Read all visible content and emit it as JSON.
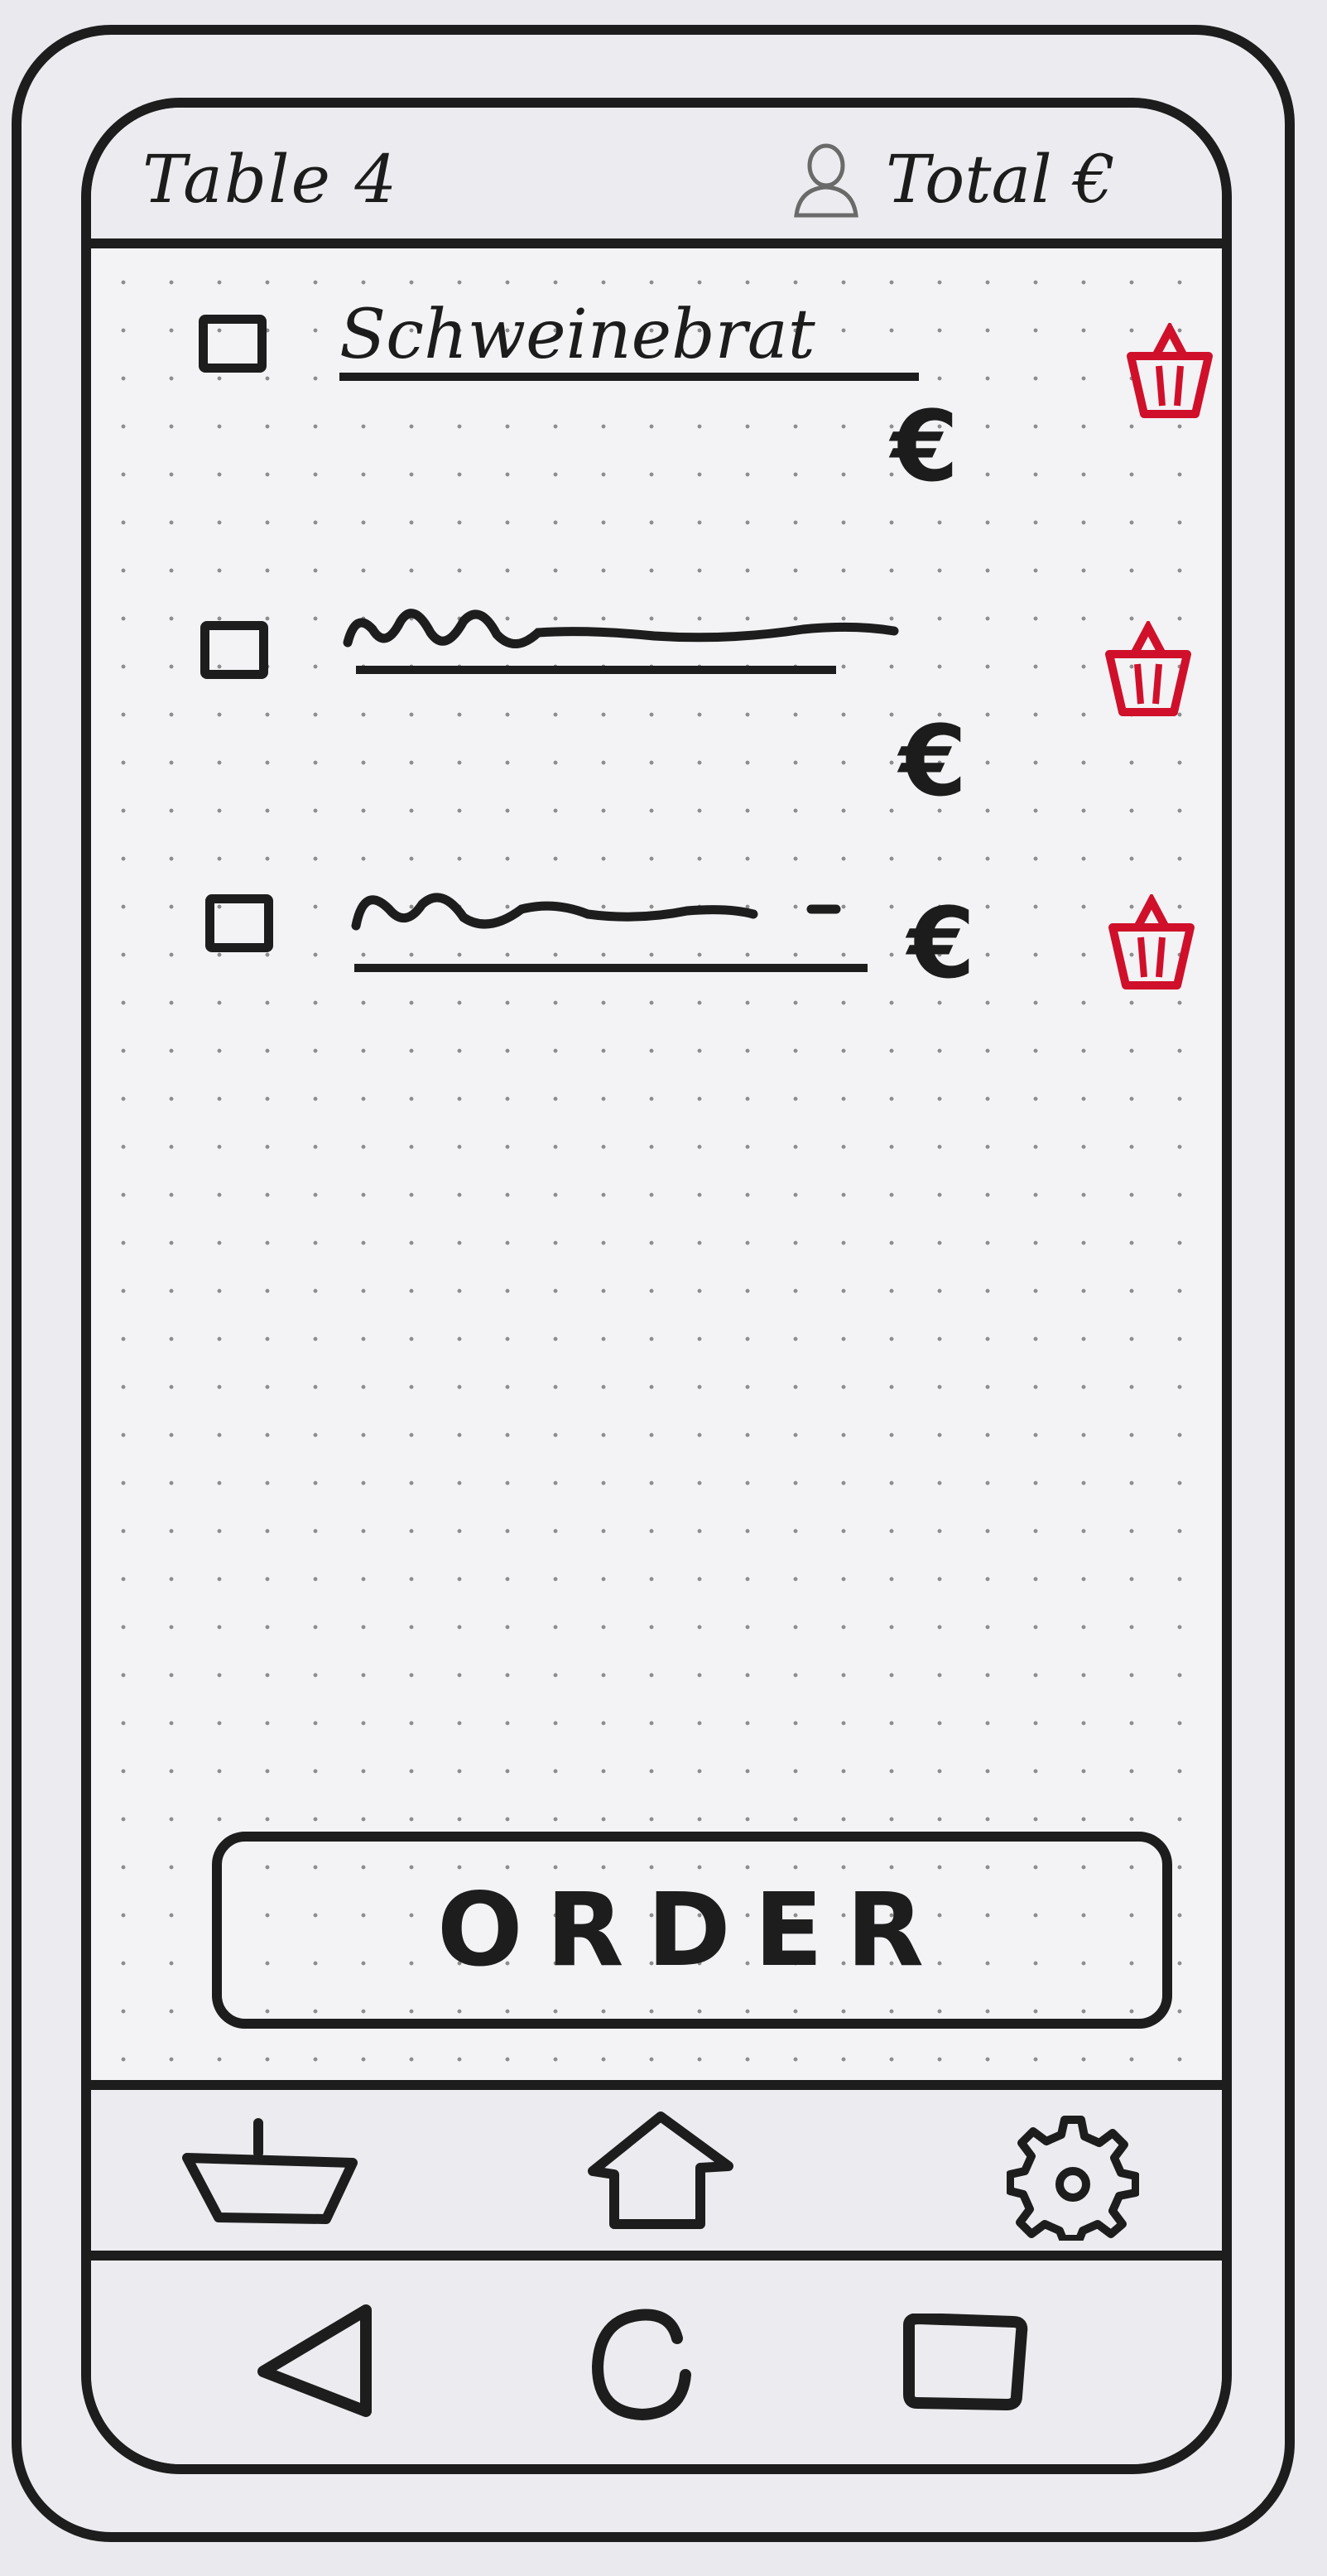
{
  "header": {
    "table_label": "Table 4",
    "total_label": "Total €",
    "user_icon": "user-icon"
  },
  "order_items": [
    {
      "name": "Schweinebrat",
      "price": "€",
      "checked": false,
      "delete_icon": "trash-basket-icon"
    },
    {
      "name": "",
      "price": "€",
      "checked": false,
      "delete_icon": "trash-basket-icon"
    },
    {
      "name": "",
      "price": "€",
      "checked": false,
      "delete_icon": "trash-basket-icon"
    }
  ],
  "order_button": {
    "label": "ORDER"
  },
  "app_nav": [
    {
      "icon": "basket-icon"
    },
    {
      "icon": "home-icon"
    },
    {
      "icon": "gear-icon"
    }
  ],
  "system_nav": [
    {
      "icon": "back-icon"
    },
    {
      "icon": "home-circle-icon"
    },
    {
      "icon": "recents-icon"
    }
  ],
  "colors": {
    "ink": "#1d1d1d",
    "delete_red": "#d0102a",
    "paper": "#ececf0"
  }
}
